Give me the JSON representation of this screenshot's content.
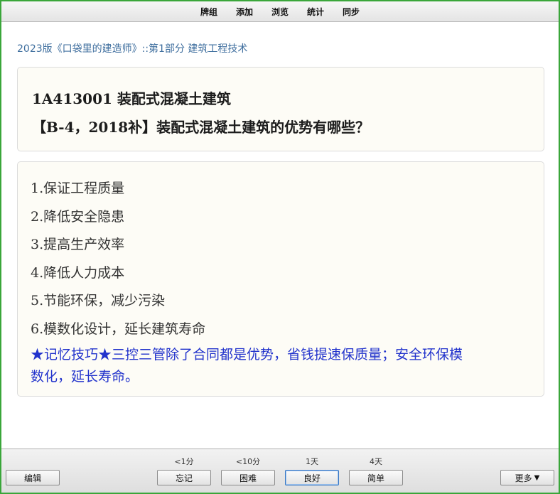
{
  "topbar": {
    "items": [
      "牌组",
      "添加",
      "浏览",
      "统计",
      "同步"
    ]
  },
  "deck_path": "2023版《口袋里的建造师》::第1部分 建筑工程技术",
  "question": {
    "line1": "1A413001 装配式混凝土建筑",
    "line2": "【B-4，2018补】装配式混凝土建筑的优势有哪些？"
  },
  "answer": {
    "items": [
      "1.保证工程质量",
      "2.降低安全隐患",
      "3.提高生产效率",
      "4.降低人力成本",
      "5.节能环保，减少污染",
      "6.模数化设计，延长建筑寿命"
    ],
    "tip_line1": "★记忆技巧★三控三管除了合同都是优势，省钱提速保质量；安全环保模",
    "tip_line2": "数化，延长寿命。"
  },
  "bottombar": {
    "edit_label": "编辑",
    "more_label": "更多",
    "more_arrow": "▼",
    "answers": [
      {
        "interval": "<1分",
        "label": "忘记"
      },
      {
        "interval": "<10分",
        "label": "困难"
      },
      {
        "interval": "1天",
        "label": "良好"
      },
      {
        "interval": "4天",
        "label": "简单"
      }
    ]
  },
  "colors": {
    "window_border": "#3aa63a",
    "deck_path": "#3e6e9e",
    "memory_tip": "#2233cc",
    "card_bg": "#fdfcf6"
  }
}
